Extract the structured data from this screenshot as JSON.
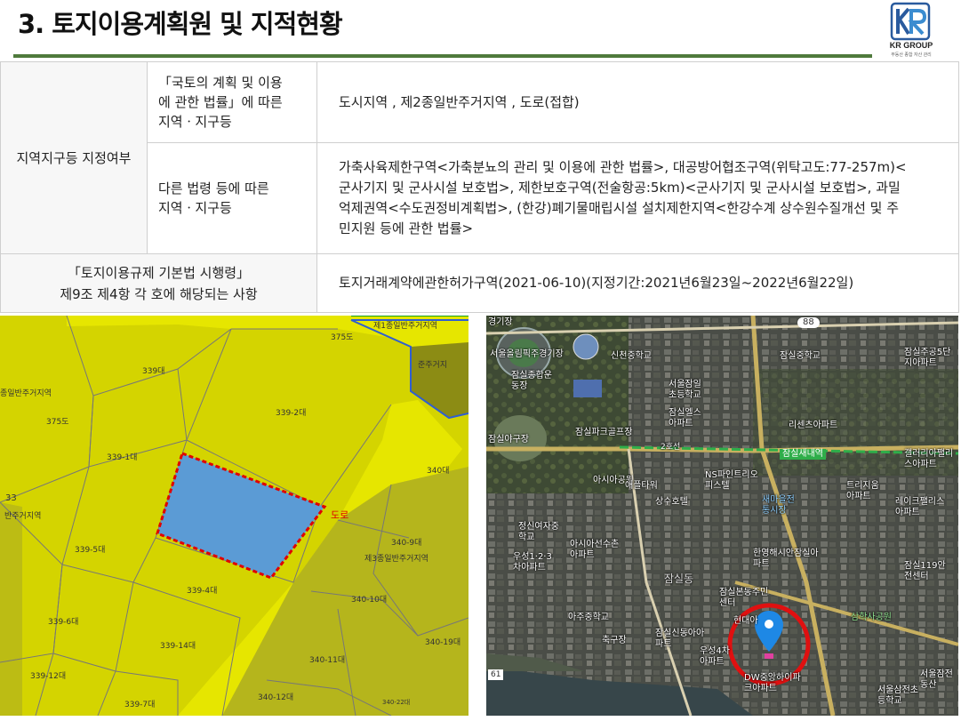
{
  "header": {
    "title": "3. 토지이용계획원 및 지적현황",
    "logo_name": "KR GROUP",
    "logo_sub": "부동산 종합 자산 관리"
  },
  "table": {
    "row_label": "지역지구등 지정여부",
    "sub1_label": [
      "「국토의 계획 및 이용",
      "에 관한 법률」에 따른",
      "지역ㆍ지구등"
    ],
    "sub1_value": "도시지역 , 제2종일반주거지역 , 도로(접합)",
    "sub2_label": [
      "다른 법령 등에 따른",
      "지역ㆍ지구등"
    ],
    "sub2_value": [
      "가축사육제한구역<가축분뇨의 관리 및 이용에 관한 법률>, 대공방어협조구역(위탁고도:77-257m)<",
      "군사기지 및 군사시설 보호법>, 제한보호구역(전술항공:5km)<군사기지 및 군사시설 보호법>, 과밀",
      "억제권역<수도권정비계획법>, (한강)폐기물매립시설 설치제한지역<한강수계 상수원수질개선 및 주",
      "민지원 등에 관한 법률>"
    ],
    "row2_label": [
      "「토지이용규제 기본법 시행령」",
      "제9조 제4항 각 호에 해당되는 사항"
    ],
    "row2_value": "토지거래계약에관한허가구역(2021-06-10)(지정기간:2021년6월23일~2022년6월22일)"
  },
  "cadastral_map": {
    "colors": {
      "parcel": "#d4d400",
      "road": "#eeee00",
      "subject": "#5b9bd5",
      "boundary": "#e00000",
      "zone_line": "#2f5fd0"
    },
    "labels": {
      "zone_top": "제1종일반주거지역",
      "zone_left": "종일반주거지역",
      "zone_right": "준주거지",
      "zone_left2": "반주거지역",
      "zone3": "제3종일반주거지역",
      "road": "도로",
      "p375a": "375도",
      "p375b": "375도",
      "p339": "339대",
      "p339_2": "339-2대",
      "p339_1": "339-1대",
      "p340": "340대",
      "p339_5": "339-5대",
      "p340_9": "340-9대",
      "p339_4": "339-4대",
      "p339_6": "339-6대",
      "p340_10": "340-10대",
      "p339_14": "339-14대",
      "p340_19": "340-19대",
      "p339_12": "339-12대",
      "p340_11": "340-11대",
      "p339_7": "339-7대",
      "p340_12": "340-12대",
      "p340_22": "340-22대",
      "edge33": "33"
    }
  },
  "satellite_map": {
    "labels": {
      "road88": "88",
      "road61": "61",
      "gyeonggi": "경기장",
      "stadium": "서울올림픽주경기장",
      "sports": "잠실종합운동장",
      "baseball": "잠실야구장",
      "shincheon": "신천중학교",
      "jamsil_elem": "서울잠일초등학교",
      "jamsil_middle": "잠실중학교",
      "jamsil_ju": "잠실주공5단지아파트",
      "els": "잠실엘스아파트",
      "park": "잠실파크골프장",
      "ricenz": "리센츠아파트",
      "saenae": "잠실새내역",
      "gallery": "갤러리아팰리스아파트",
      "asia_park": "아시아공원",
      "apple": "애플타워",
      "ns": "NS파인트리오피스텔",
      "sangsu": "상수호텔",
      "market": "새마을전통시장",
      "trisiom": "트리지움아파트",
      "lake": "레이크팰리스아파트",
      "jeongsin": "정신여자중학교",
      "athletes": "아시아선수촌아파트",
      "woosung12": "우성1·2·3차아파트",
      "hanyoung": "한영해시안잠실아파트",
      "safety": "잠실119안전센터",
      "bon": "잠실본동주민센터",
      "samhak": "삼학사공원",
      "asju": "아주중학교",
      "chuk": "축구장",
      "sindong": "잠실신동아아파트",
      "woo4": "우성4차아파트",
      "hyundai": "현대아",
      "dw": "DW중앙하이파크아파트",
      "samjeon": "서울삼전초등학교",
      "dongsan": "서울잠전동산",
      "road_2": "2호선",
      "jamsil_area": "잠실동",
      "area_bon": "잠실본동"
    },
    "marker_color": "#1e88e5",
    "circle_color": "#e01010"
  }
}
